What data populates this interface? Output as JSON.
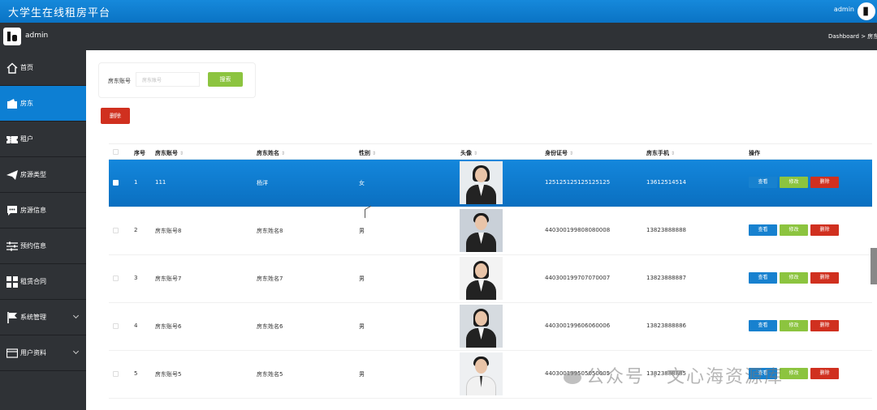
{
  "app": {
    "title": "大学生在线租房平台",
    "user": "admin"
  },
  "subheader": {
    "username": "admin",
    "breadcrumb": "Dashboard > 房东"
  },
  "sidebar": {
    "items": [
      {
        "label": "首页",
        "icon": "home-icon",
        "active": false,
        "expandable": false
      },
      {
        "label": "房东",
        "icon": "wallet-icon",
        "active": true,
        "expandable": false
      },
      {
        "label": "租户",
        "icon": "ticket-icon",
        "active": false,
        "expandable": false
      },
      {
        "label": "房源类型",
        "icon": "send-icon",
        "active": false,
        "expandable": false
      },
      {
        "label": "房源信息",
        "icon": "message-icon",
        "active": false,
        "expandable": false
      },
      {
        "label": "预约信息",
        "icon": "sliders-icon",
        "active": false,
        "expandable": false
      },
      {
        "label": "租赁合同",
        "icon": "grid-icon",
        "active": false,
        "expandable": false
      },
      {
        "label": "系统管理",
        "icon": "flag-icon",
        "active": false,
        "expandable": true
      },
      {
        "label": "用户资料",
        "icon": "card-icon",
        "active": false,
        "expandable": true
      }
    ]
  },
  "search": {
    "label": "房东账号",
    "placeholder": "房东账号",
    "button": "搜索"
  },
  "toolbar": {
    "delete_label": "删除"
  },
  "table": {
    "headers": [
      "序号",
      "房东账号",
      "房东姓名",
      "性别",
      "头像",
      "身份证号",
      "房东手机",
      "操作"
    ],
    "rows": [
      {
        "no": "1",
        "account": "111",
        "name": "杨洋",
        "gender": "女",
        "id_card": "125125125125125125",
        "phone": "13612514514",
        "selected": true
      },
      {
        "no": "2",
        "account": "房东账号8",
        "name": "房东姓名8",
        "gender": "男",
        "id_card": "440300199808080008",
        "phone": "13823888888",
        "selected": false
      },
      {
        "no": "3",
        "account": "房东账号7",
        "name": "房东姓名7",
        "gender": "男",
        "id_card": "440300199707070007",
        "phone": "13823888887",
        "selected": false
      },
      {
        "no": "4",
        "account": "房东账号6",
        "name": "房东姓名6",
        "gender": "男",
        "id_card": "440300199606060006",
        "phone": "13823888886",
        "selected": false
      },
      {
        "no": "5",
        "account": "房东账号5",
        "name": "房东姓名5",
        "gender": "男",
        "id_card": "440300199505050005",
        "phone": "13823888885",
        "selected": false
      }
    ],
    "actions": {
      "view": "查看",
      "edit": "修改",
      "delete": "删除"
    }
  },
  "watermark": "公众号 · 文心海资源库",
  "colors": {
    "header": "#0a73c4",
    "sidebar": "#2f3236",
    "active": "#0d7fd3",
    "edit": "#8cc43f",
    "delete": "#d0301f",
    "view": "#1781cf"
  }
}
